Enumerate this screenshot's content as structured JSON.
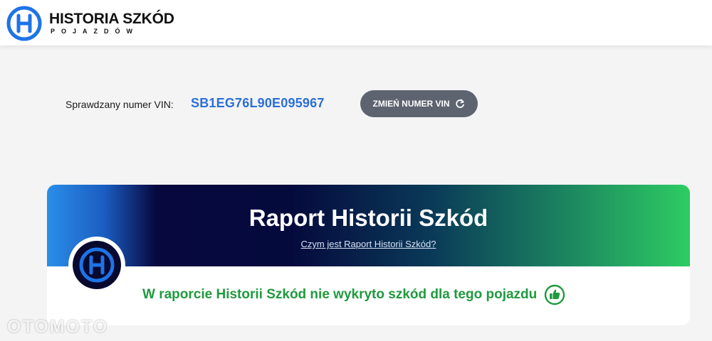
{
  "header": {
    "logo_title": "HISTORIA SZKÓD",
    "logo_subtitle": "POJAZDÓW",
    "logo_icon": "hs-logo-icon"
  },
  "vin": {
    "label": "Sprawdzany numer VIN:",
    "value": "SB1EG76L90E095967",
    "change_button_label": "ZMIEŃ NUMER VIN",
    "change_button_icon": "refresh-icon"
  },
  "report": {
    "title": "Raport Historii Szkód",
    "info_link": "Czym jest Raport Historii Szkód?",
    "result_text": "W raporcie Historii Szkód nie wykryto szkód dla tego pojazdu",
    "result_icon": "thumbs-up-icon",
    "badge_icon": "hs-logo-icon"
  },
  "watermark": "OTOMOTO",
  "colors": {
    "brand_blue": "#2a6fdb",
    "button_gray": "#5d6470",
    "success_green": "#1f9a3e",
    "gradient_start": "#2a8ee8",
    "gradient_mid": "#050a3d",
    "gradient_end": "#2ecc63"
  }
}
